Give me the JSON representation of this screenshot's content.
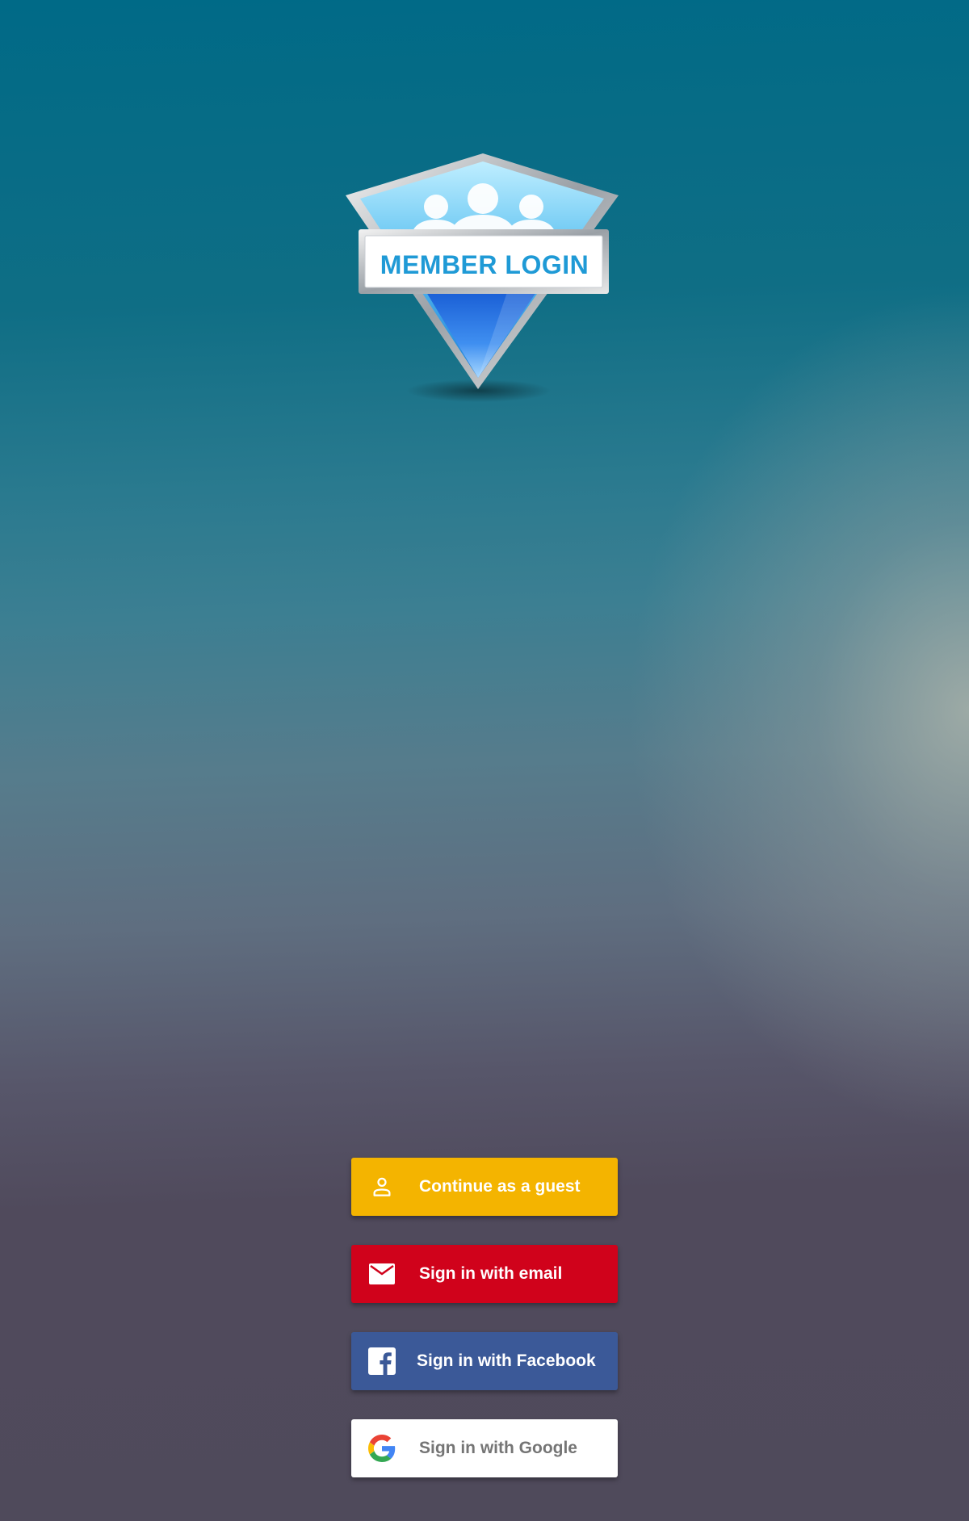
{
  "logo": {
    "text": "MEMBER LOGIN"
  },
  "buttons": {
    "guest": {
      "label": "Continue as a guest",
      "icon": "person-icon",
      "color": "#f4b400"
    },
    "email": {
      "label": "Sign in with email",
      "icon": "mail-icon",
      "color": "#d0021b"
    },
    "facebook": {
      "label": "Sign in with Facebook",
      "icon": "facebook-icon",
      "color": "#3b5998"
    },
    "google": {
      "label": "Sign in with Google",
      "icon": "google-icon",
      "color": "#ffffff"
    }
  }
}
